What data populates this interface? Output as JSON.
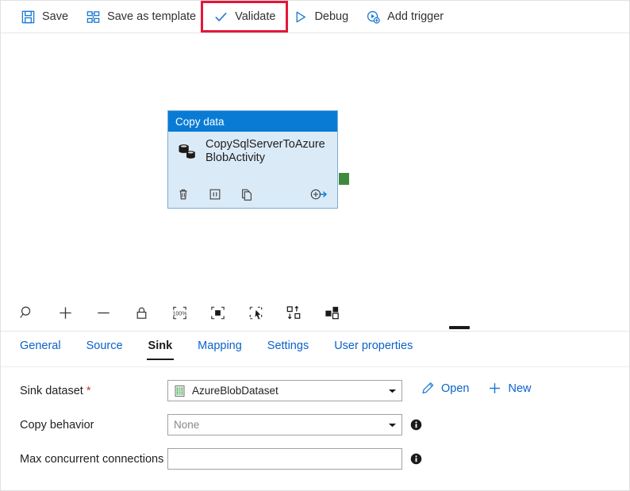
{
  "command_bar": {
    "buttons": [
      {
        "label": "Save",
        "icon": "save-icon",
        "highlighted": false
      },
      {
        "label": "Save as template",
        "icon": "save-as-template-icon",
        "highlighted": false
      },
      {
        "label": "Validate",
        "icon": "checkmark-icon",
        "highlighted": true
      },
      {
        "label": "Debug",
        "icon": "play-triangle-icon",
        "highlighted": false
      },
      {
        "label": "Add trigger",
        "icon": "add-trigger-icon",
        "highlighted": false
      }
    ],
    "highlight_color": "#e3173a"
  },
  "canvas": {
    "annotation": {
      "name": "red-circle-annotation",
      "color": "#e3173a"
    },
    "node": {
      "header": "Copy data",
      "title": "CopySqlServerToAzureBlobActivity",
      "header_color": "#0a7bd4",
      "body_color": "#dbeaf7",
      "connector_color": "#3f8a3f",
      "actions": [
        {
          "name": "delete-activity-icon"
        },
        {
          "name": "code-view-icon"
        },
        {
          "name": "clone-activity-icon"
        },
        {
          "name": "add-output-icon"
        }
      ]
    }
  },
  "canvas_toolbar": {
    "tools": [
      {
        "name": "zoom-search-icon"
      },
      {
        "name": "zoom-in-icon"
      },
      {
        "name": "zoom-out-icon"
      },
      {
        "name": "lock-icon"
      },
      {
        "name": "zoom-100-percent-icon",
        "label": "100%"
      },
      {
        "name": "zoom-to-fit-icon"
      },
      {
        "name": "select-all-icon"
      },
      {
        "name": "auto-align-icon"
      },
      {
        "name": "group-layout-icon"
      }
    ]
  },
  "tabs": [
    {
      "label": "General",
      "active": false
    },
    {
      "label": "Source",
      "active": false
    },
    {
      "label": "Sink",
      "active": true
    },
    {
      "label": "Mapping",
      "active": false
    },
    {
      "label": "Settings",
      "active": false
    },
    {
      "label": "User properties",
      "active": false
    }
  ],
  "form": {
    "sink_dataset": {
      "label": "Sink dataset",
      "required_marker": "*",
      "value": "AzureBlobDataset",
      "dataset_icon": "csv-dataset-icon",
      "open_label": "Open",
      "new_label": "New"
    },
    "copy_behavior": {
      "label": "Copy behavior",
      "placeholder": "None",
      "value": ""
    },
    "max_concurrent_connections": {
      "label": "Max concurrent connections",
      "value": "",
      "placeholder": ""
    }
  }
}
